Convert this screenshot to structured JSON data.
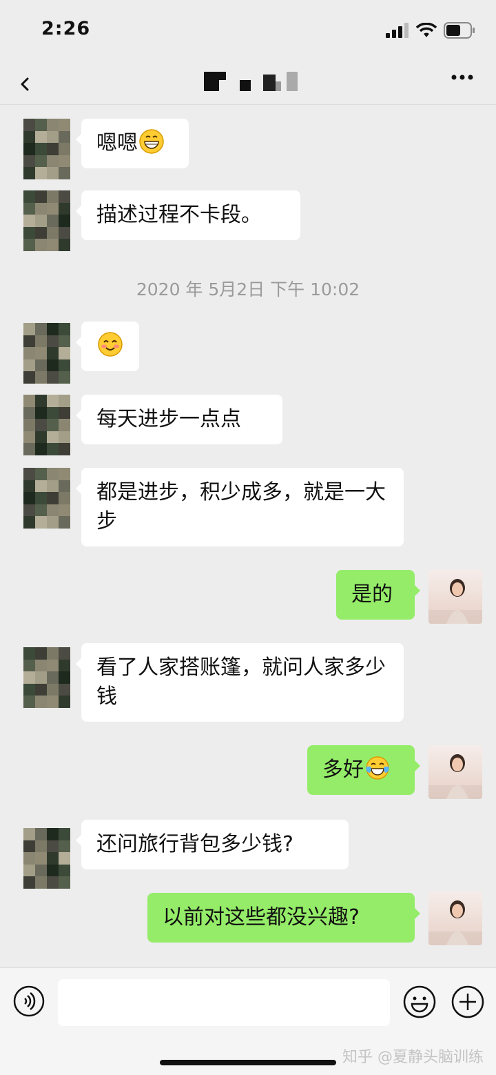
{
  "status_bar": {
    "time": "2:26",
    "icons": [
      "signal-icon",
      "wifi-icon",
      "battery-icon"
    ]
  },
  "nav": {
    "back_icon": "chevron-left-icon",
    "more_icon": "more-icon"
  },
  "colors": {
    "background": "#ededed",
    "bubble_left": "#ffffff",
    "bubble_right": "#95ec69",
    "timestamp": "#9a9a9a"
  },
  "messages": [
    {
      "side": "left",
      "text": "嗯嗯",
      "emoji": "grin-emoji"
    },
    {
      "side": "left",
      "text": "描述过程不卡段。"
    },
    {
      "type": "timestamp",
      "text": "2020 年 5月2日 下午 10:02"
    },
    {
      "side": "left",
      "text": "",
      "emoji": "smile-emoji"
    },
    {
      "side": "left",
      "text": "每天进步一点点"
    },
    {
      "side": "left",
      "text": "都是进步，积少成多，就是一大步"
    },
    {
      "side": "right",
      "text": "是的"
    },
    {
      "side": "left",
      "text": "看了人家搭账篷，就问人家多少钱"
    },
    {
      "side": "right",
      "text": "多好",
      "emoji": "tears-of-joy-emoji"
    },
    {
      "side": "left",
      "text": "还问旅行背包多少钱?"
    },
    {
      "side": "right",
      "text": "以前对这些都没兴趣?"
    }
  ],
  "input_bar": {
    "placeholder": "",
    "value": ""
  },
  "watermark": "知乎 @夏静头脑训练"
}
